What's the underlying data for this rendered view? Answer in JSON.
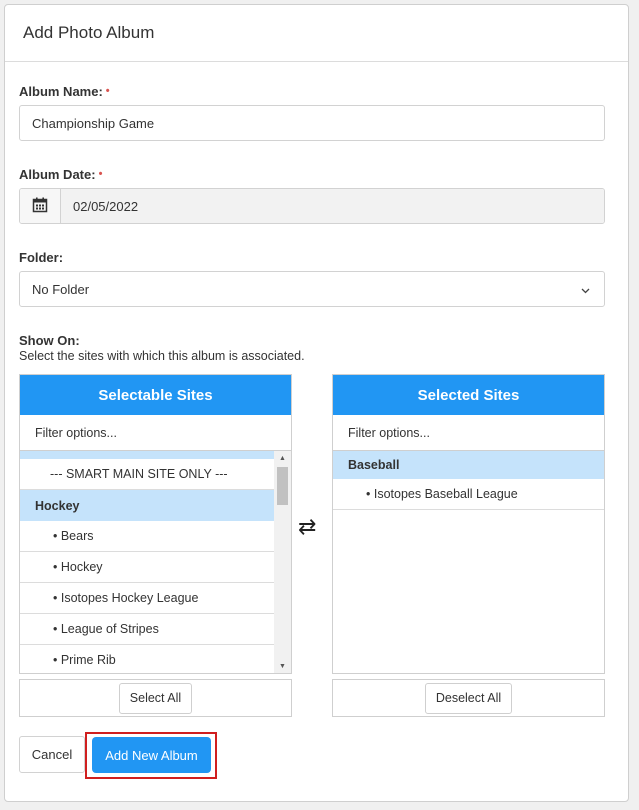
{
  "dialog": {
    "title": "Add Photo Album"
  },
  "album_name": {
    "label": "Album Name:",
    "required_mark": "•",
    "value": "Championship Game"
  },
  "album_date": {
    "label": "Album Date:",
    "required_mark": "•",
    "value": "02/05/2022"
  },
  "folder": {
    "label": "Folder:",
    "value": "No Folder"
  },
  "show_on": {
    "label": "Show On:",
    "hint": "Select the sites with which this album is associated.",
    "selectable": {
      "title": "Selectable Sites",
      "filter_placeholder": "Filter options...",
      "top_item": "--- SMART MAIN SITE ONLY ---",
      "group": "Hockey",
      "items": [
        "• Bears",
        "• Hockey",
        "• Isotopes Hockey League",
        "• League of Stripes",
        "• Prime Rib"
      ],
      "button": "Select All"
    },
    "selected": {
      "title": "Selected Sites",
      "filter_placeholder": "Filter options...",
      "group": "Baseball",
      "items": [
        "• Isotopes Baseball League"
      ],
      "button": "Deselect All"
    },
    "swap_symbol": "⇄"
  },
  "actions": {
    "cancel": "Cancel",
    "submit": "Add New Album"
  },
  "colors": {
    "primary": "#2196f3",
    "group_bg": "#c5e3fb",
    "highlight": "#d01f1f",
    "required": "#d9534f"
  }
}
